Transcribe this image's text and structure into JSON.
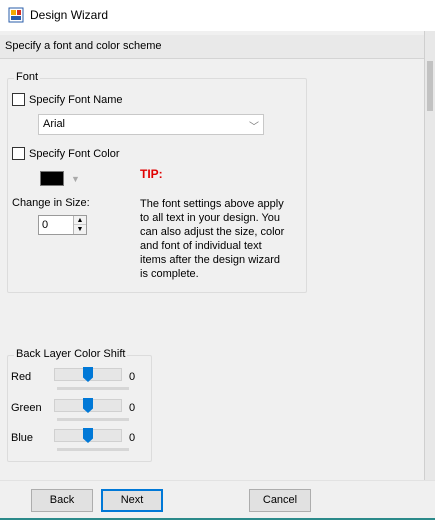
{
  "window": {
    "title": "Design Wizard"
  },
  "header": {
    "subtitle": "Specify a font and color scheme"
  },
  "font_group": {
    "legend": "Font",
    "specify_font_name": {
      "label": "Specify Font Name",
      "checked": false
    },
    "font_combo": {
      "value": "Arial"
    },
    "specify_font_color": {
      "label": "Specify Font Color",
      "checked": false
    },
    "font_color": "#000000",
    "change_in_size": {
      "label": "Change in Size:",
      "value": "0"
    },
    "tip": {
      "title": "TIP:",
      "text": "The font settings above apply to all text in your design. You can also adjust the size, color and font of individual text items after the design wizard is complete."
    }
  },
  "back_layer": {
    "legend": "Back Layer Color Shift",
    "channels": [
      {
        "label": "Red",
        "value": "0"
      },
      {
        "label": "Green",
        "value": "0"
      },
      {
        "label": "Blue",
        "value": "0"
      }
    ]
  },
  "footer": {
    "back_label": "Back",
    "next_label": "Next",
    "cancel_label": "Cancel"
  }
}
